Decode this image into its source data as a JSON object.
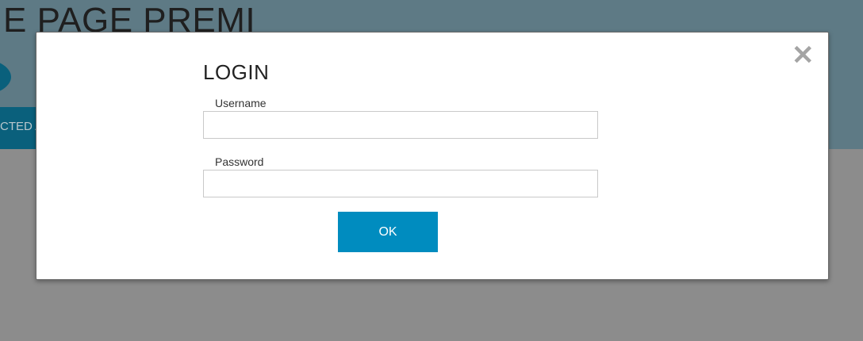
{
  "background": {
    "page_title_fragment": "E PAGE PREMI",
    "tab_label_fragment": "CTED A"
  },
  "login": {
    "title": "LOGIN",
    "username_label": "Username",
    "username_value": "",
    "password_label": "Password",
    "password_value": "",
    "ok_label": "OK",
    "close_icon": "close-icon",
    "close_glyph": "✕"
  },
  "colors": {
    "header_bg": "#5e7a85",
    "overlay_bg": "#8c8c8c",
    "accent": "#008cbf",
    "dark_accent": "#0a607c"
  }
}
